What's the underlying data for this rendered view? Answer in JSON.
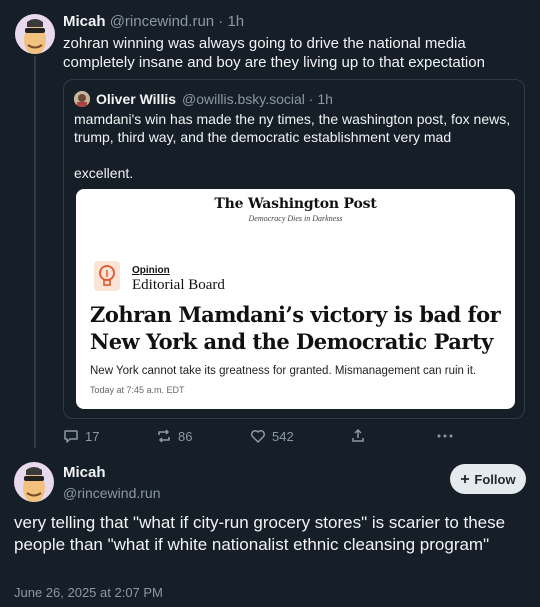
{
  "thread": {
    "post1": {
      "display_name": "Micah",
      "handle_time": "@rincewind.run · 1h",
      "text": "zohran winning was always going to drive the national media completely insane and boy are they living up to that expectation"
    },
    "quote": {
      "display_name": "Oliver Willis",
      "handle_time": "@owillis.bsky.social · 1h",
      "text": "mamdani's win has made the ny times, the washington post, fox news, trump, third way, and the democratic establishment very mad",
      "text2": "excellent.",
      "card": {
        "masthead": "The Washington Post",
        "tagline": "Democracy Dies in Darkness",
        "section": "Opinion",
        "board": "Editorial Board",
        "headline": "Zohran Mamdani’s victory is bad for New York and the Democratic Party",
        "dek": "New York cannot take its greatness for granted. Mismanagement can ruin it.",
        "date": "Today at 7:45 a.m. EDT"
      }
    },
    "actions": {
      "reply_count": "17",
      "repost_count": "86",
      "like_count": "542"
    },
    "post2": {
      "display_name": "Micah",
      "handle": "@rincewind.run",
      "follow_label": "Follow",
      "text": "very telling that \"what if city-run grocery stores\" is scarier to these people than \"what if white nationalist ethnic cleansing program\"",
      "date": "June 26, 2025 at 2:07 PM"
    }
  },
  "colors": {
    "background": "#161e27",
    "muted_text": "#8b98a5",
    "follow_button": "#e5eaee"
  },
  "icons": [
    "reply-icon",
    "repost-icon",
    "like-icon",
    "share-icon",
    "more-icon",
    "plus-icon",
    "lightbulb-icon"
  ]
}
